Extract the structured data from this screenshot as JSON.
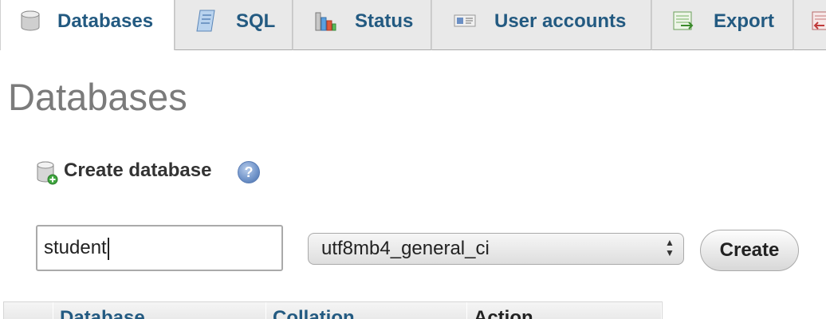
{
  "tabs": [
    {
      "label": "Databases",
      "icon": "database-icon",
      "active": true
    },
    {
      "label": "SQL",
      "icon": "sql-scroll-icon",
      "active": false
    },
    {
      "label": "Status",
      "icon": "status-chart-icon",
      "active": false
    },
    {
      "label": "User accounts",
      "icon": "user-card-icon",
      "active": false
    },
    {
      "label": "Export",
      "icon": "export-icon",
      "active": false
    },
    {
      "label": "",
      "icon": "import-icon",
      "active": false
    }
  ],
  "page_title": "Databases",
  "create": {
    "label": "Create database",
    "help_icon": "help-icon",
    "db_name_value": "student",
    "collation_value": "utf8mb4_general_ci",
    "button_label": "Create"
  },
  "table": {
    "headers": [
      "",
      "Database",
      "Collation",
      "Action"
    ]
  },
  "colors": {
    "link": "#235a81",
    "title": "#7b7b7b",
    "tab_bg": "#e9e9e9"
  }
}
